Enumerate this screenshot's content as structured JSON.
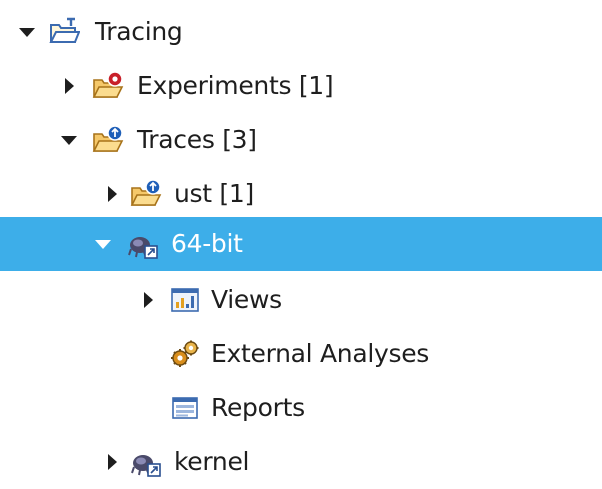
{
  "tree": {
    "items": [
      {
        "label": "Tracing",
        "icon": "tracing-project-folder-icon",
        "twisty": "expanded"
      },
      {
        "label": "Experiments [1]",
        "icon": "experiments-folder-icon",
        "twisty": "collapsed"
      },
      {
        "label": "Traces [3]",
        "icon": "traces-folder-icon",
        "twisty": "expanded"
      },
      {
        "label": "ust [1]",
        "icon": "traces-subfolder-icon",
        "twisty": "collapsed"
      },
      {
        "label": "64-bit",
        "icon": "trace-icon",
        "twisty": "expanded",
        "selected": true
      },
      {
        "label": "Views",
        "icon": "views-icon",
        "twisty": "collapsed"
      },
      {
        "label": "External Analyses",
        "icon": "external-analyses-icon",
        "twisty": "none"
      },
      {
        "label": "Reports",
        "icon": "reports-icon",
        "twisty": "none"
      },
      {
        "label": "kernel",
        "icon": "trace-icon",
        "twisty": "collapsed"
      }
    ]
  },
  "colors": {
    "selection": "#3daee9",
    "text": "#1e1e1e",
    "selected_text": "#ffffff",
    "folder": "#f2b63c"
  }
}
